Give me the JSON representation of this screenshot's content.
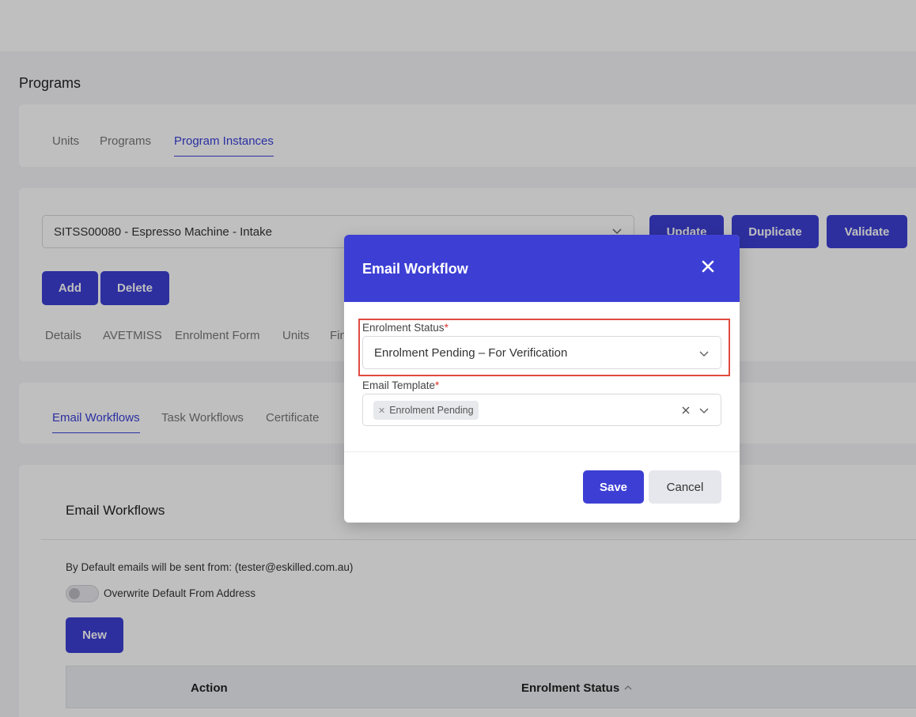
{
  "page": {
    "title": "Programs",
    "tabs": [
      "Units",
      "Programs",
      "Program Instances"
    ],
    "active_tab": "Program Instances"
  },
  "instance": {
    "selected": "SITSS00080 - Espresso Machine - Intake",
    "buttons": {
      "update": "Update",
      "duplicate": "Duplicate",
      "validate": "Validate",
      "add": "Add",
      "delete": "Delete"
    },
    "subtabs": [
      "Details",
      "AVETMISS",
      "Enrolment Form",
      "Units",
      "Fin"
    ]
  },
  "workflow_tabs": [
    "Email Workflows",
    "Task Workflows",
    "Certificate"
  ],
  "email_workflows": {
    "title": "Email Workflows",
    "info": "By Default emails will be sent from: (tester@eskilled.com.au)",
    "toggle_label": "Overwrite Default From Address",
    "new_button": "New",
    "columns": [
      "Action",
      "Enrolment Status"
    ]
  },
  "modal": {
    "title": "Email Workflow",
    "status_label": "Enrolment Status",
    "status_value": "Enrolment Pending – For Verification",
    "template_label": "Email Template",
    "template_chip": "Enrolment Pending",
    "required_mark": "*",
    "save": "Save",
    "cancel": "Cancel"
  },
  "colors": {
    "accent": "#3d3fd4",
    "highlight": "#e04b3f",
    "required": "#e0322b"
  }
}
